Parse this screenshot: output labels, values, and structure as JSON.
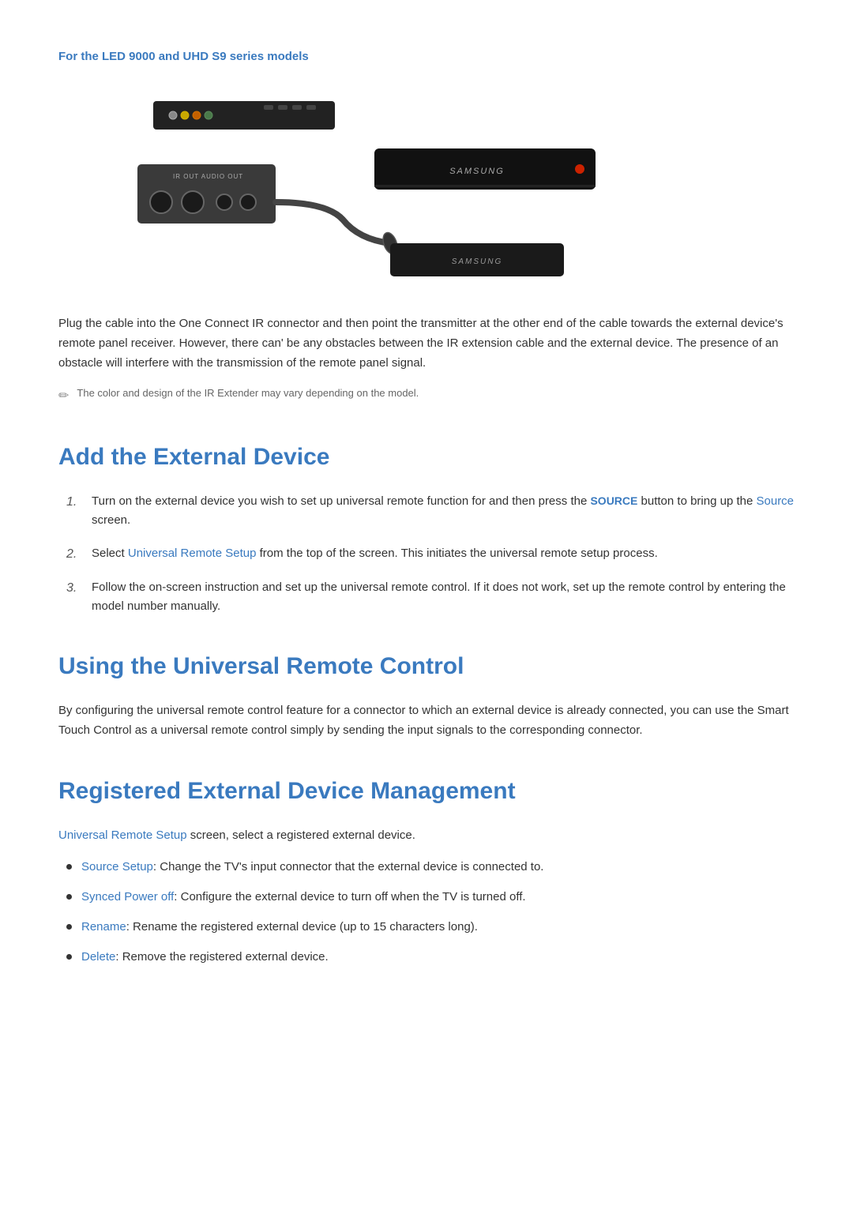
{
  "page": {
    "subtitle": "For the LED 9000 and UHD S9 series models",
    "intro_paragraph": "Plug the cable into the One Connect IR connector and then point the transmitter at the other end of the cable towards the external device's remote panel receiver. However, there can' be any obstacles between the IR extension cable and the external device. The presence of an obstacle will interfere with the transmission of the remote panel signal.",
    "note_text": "The color and design of the IR Extender may vary depending on the model.",
    "section1": {
      "heading": "Add the External Device",
      "items": [
        {
          "num": "1.",
          "text_before": "Turn on the external device you wish to set up universal remote function for and then press the ",
          "link1": "SOURCE",
          "text_middle": " button to bring up the ",
          "link2": "Source",
          "text_after": " screen."
        },
        {
          "num": "2.",
          "text_before": "Select ",
          "link1": "Universal Remote Setup",
          "text_after": " from the top of the screen. This initiates the universal remote setup process."
        },
        {
          "num": "3.",
          "text": "Follow the on-screen instruction and set up the universal remote control. If it does not work, set up the remote control by entering the model number manually."
        }
      ]
    },
    "section2": {
      "heading": "Using the Universal Remote Control",
      "body": "By configuring the universal remote control feature for a connector to which an external device is already connected, you can use the Smart Touch Control as a universal remote control simply by sending the input signals to the corresponding connector."
    },
    "section3": {
      "heading": "Registered External Device Management",
      "intro_link": "Universal Remote Setup",
      "intro_text": " screen, select a registered external device.",
      "bullets": [
        {
          "link": "Source Setup",
          "text": ": Change the TV's input connector that the external device is connected to."
        },
        {
          "link": "Synced Power off",
          "text": ": Configure the external device to turn off when the TV is turned off."
        },
        {
          "link": "Rename",
          "text": ": Rename the registered external device (up to 15 characters long)."
        },
        {
          "link": "Delete",
          "text": ": Remove the registered external device."
        }
      ]
    }
  }
}
